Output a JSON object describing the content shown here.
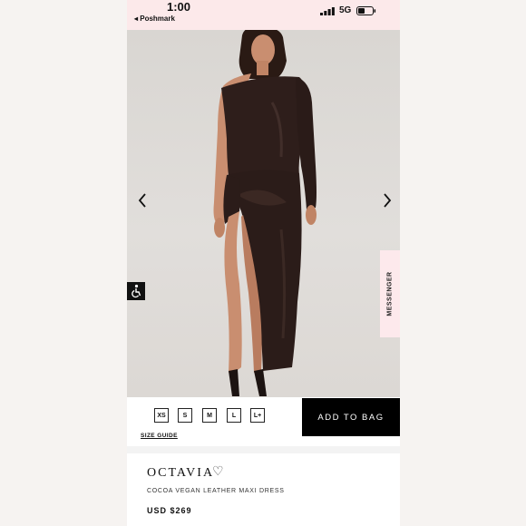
{
  "status": {
    "time": "1:00",
    "back_app": "◂ Poshmark",
    "network": "5G"
  },
  "icons": {
    "signal": "cellular-signal-icon",
    "battery": "battery-icon",
    "prev": "chevron-left-icon",
    "next": "chevron-right-icon",
    "accessibility": "accessibility-icon",
    "wishlist": "heart-icon"
  },
  "gallery": {
    "messenger_label": "MESSENGER"
  },
  "purchase": {
    "sizes": [
      "XS",
      "S",
      "M",
      "L",
      "L+"
    ],
    "size_guide_label": "SIZE GUIDE",
    "add_to_bag_label": "ADD TO BAG"
  },
  "product": {
    "name": "OCTAVIA",
    "heart_glyph": "♡",
    "description": "COCOA VEGAN LEATHER MAXI DRESS",
    "price": "USD $269"
  },
  "colors": {
    "status_bg": "#fce9ea",
    "messenger_bg": "#fde9ec",
    "button_bg": "#000000",
    "dress": "#2e1e1b"
  }
}
